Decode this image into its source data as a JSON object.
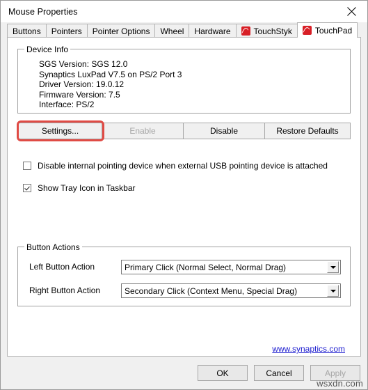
{
  "window": {
    "title": "Mouse Properties",
    "close_icon": "close-icon"
  },
  "tabs": [
    {
      "label": "Buttons",
      "icon": null,
      "active": false
    },
    {
      "label": "Pointers",
      "icon": null,
      "active": false
    },
    {
      "label": "Pointer Options",
      "icon": null,
      "active": false
    },
    {
      "label": "Wheel",
      "icon": null,
      "active": false
    },
    {
      "label": "Hardware",
      "icon": null,
      "active": false
    },
    {
      "label": "TouchStyk",
      "icon": "synaptics-icon",
      "active": false
    },
    {
      "label": "TouchPad",
      "icon": "synaptics-icon",
      "active": true
    }
  ],
  "device_info": {
    "group_title": "Device Info",
    "lines": [
      "SGS Version: SGS 12.0",
      "Synaptics LuxPad V7.5 on PS/2 Port 3",
      "Driver Version: 19.0.12",
      "Firmware Version: 7.5",
      "Interface: PS/2"
    ]
  },
  "device_buttons": [
    {
      "label": "Settings...",
      "disabled": false,
      "highlighted": true
    },
    {
      "label": "Enable",
      "disabled": true,
      "highlighted": false
    },
    {
      "label": "Disable",
      "disabled": false,
      "highlighted": false
    },
    {
      "label": "Restore Defaults",
      "disabled": false,
      "highlighted": false
    }
  ],
  "checkboxes": [
    {
      "label": "Disable internal pointing device when external USB pointing device is attached",
      "checked": false
    },
    {
      "label": "Show Tray Icon in Taskbar",
      "checked": true
    }
  ],
  "button_actions": {
    "group_title": "Button Actions",
    "rows": [
      {
        "label": "Left Button Action",
        "value": "Primary Click (Normal Select, Normal Drag)"
      },
      {
        "label": "Right Button Action",
        "value": "Secondary Click (Context Menu, Special Drag)"
      }
    ]
  },
  "link": {
    "label": "www.synaptics.com"
  },
  "footer_buttons": [
    {
      "label": "OK",
      "disabled": false
    },
    {
      "label": "Cancel",
      "disabled": false
    },
    {
      "label": "Apply",
      "disabled": true
    }
  ],
  "watermark": "wsxdn.com",
  "colors": {
    "accent_red": "#d81f26",
    "highlight_red": "#e04b45",
    "link_blue": "#2020d0",
    "dialog_bg": "#f0f0f0",
    "page_bg": "#ffffff"
  }
}
